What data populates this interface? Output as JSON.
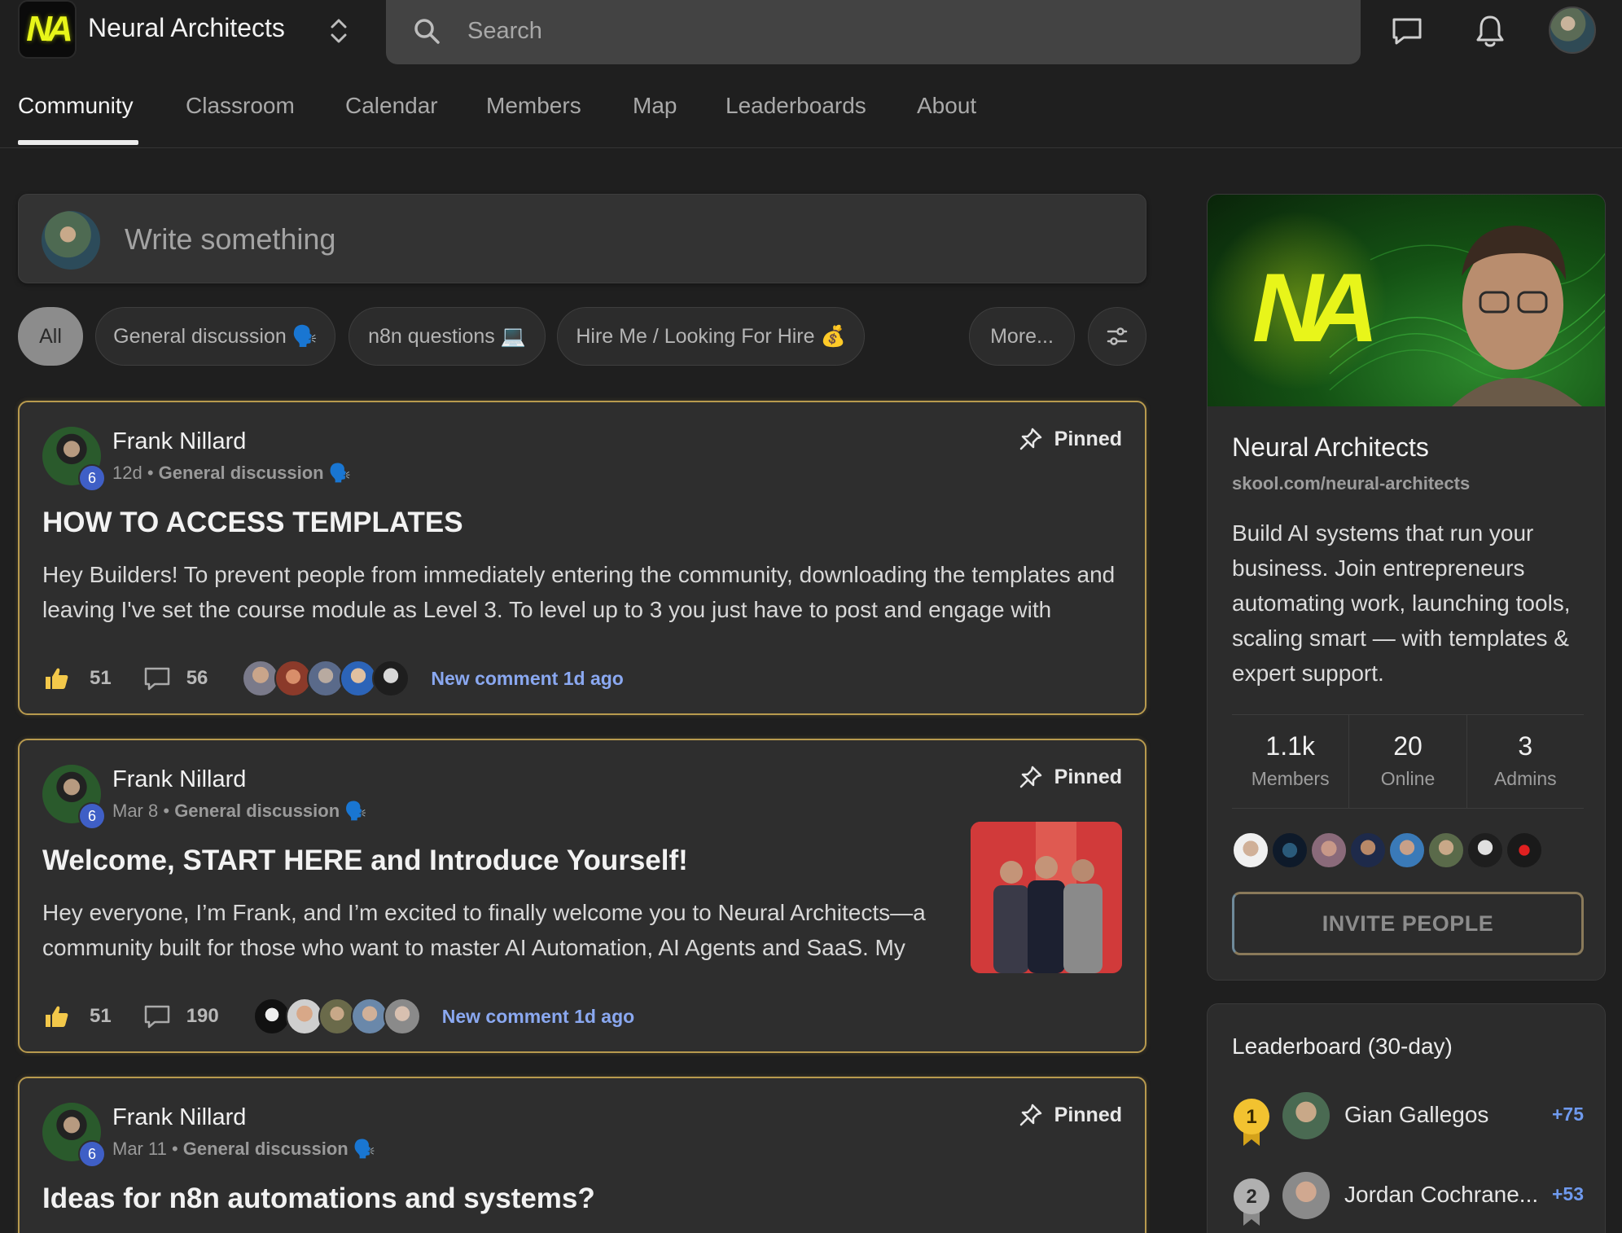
{
  "app": {
    "logo_text": "NA",
    "group_name": "Neural Architects",
    "search_placeholder": "Search"
  },
  "nav": {
    "tabs": [
      "Community",
      "Classroom",
      "Calendar",
      "Members",
      "Map",
      "Leaderboards",
      "About"
    ],
    "active": "Community"
  },
  "composer": {
    "placeholder": "Write something"
  },
  "filters": {
    "chips": [
      "All",
      "General discussion 🗣️",
      "n8n questions 💻",
      "Hire Me / Looking For Hire 💰",
      "More..."
    ],
    "active": "All"
  },
  "posts": [
    {
      "author": "Frank Nillard",
      "level": "6",
      "time": "12d",
      "category": "General discussion 🗣️",
      "pinned_label": "Pinned",
      "title": "HOW TO ACCESS TEMPLATES",
      "body": "Hey Builders! To prevent people from immediately entering the community, downloading the templates and leaving I've set the course module as Level 3. To level up to 3 you just have to post and engage with",
      "likes": "51",
      "comments": "56",
      "new_comment": "New comment 1d ago"
    },
    {
      "author": "Frank Nillard",
      "level": "6",
      "time": "Mar 8",
      "category": "General discussion 🗣️",
      "pinned_label": "Pinned",
      "title": "Welcome, START HERE and Introduce Yourself!",
      "body": "Hey everyone, I’m Frank, and I’m excited to finally welcome you to Neural Architects—a community built for those who want to master AI Automation, AI Agents and SaaS. My",
      "likes": "51",
      "comments": "190",
      "new_comment": "New comment 1d ago"
    },
    {
      "author": "Frank Nillard",
      "level": "6",
      "time": "Mar 11",
      "category": "General discussion 🗣️",
      "pinned_label": "Pinned",
      "title": "Ideas for n8n automations and systems?"
    }
  ],
  "about": {
    "name": "Neural Architects",
    "url": "skool.com/neural-architects",
    "description": "Build AI systems that run your business. Join entrepreneurs automating work, launching tools, scaling smart — with templates & expert support.",
    "stats": [
      {
        "value": "1.1k",
        "label": "Members"
      },
      {
        "value": "20",
        "label": "Online"
      },
      {
        "value": "3",
        "label": "Admins"
      }
    ],
    "invite_label": "INVITE PEOPLE"
  },
  "leaderboard": {
    "heading": "Leaderboard (30-day)",
    "rows": [
      {
        "rank": "1",
        "name": "Gian Gallegos",
        "points": "+75"
      },
      {
        "rank": "2",
        "name": "Jordan Cochrane...",
        "points": "+53"
      }
    ]
  },
  "colors": {
    "background": "#1f1f1f",
    "card": "#2e2e2e",
    "pinned_border": "#b89a4e",
    "link_blue": "#8aa8f0",
    "level_badge": "#3f5fc6",
    "logo_yellow": "#e8f51a"
  }
}
